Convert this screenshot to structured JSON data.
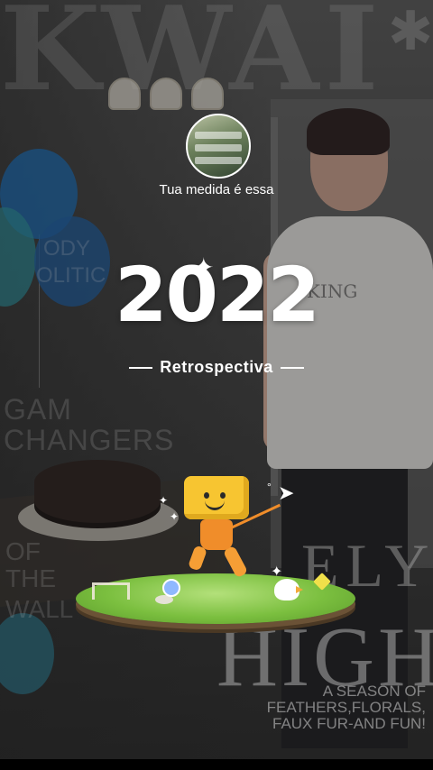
{
  "story": {
    "caption": "Tua medida é essa",
    "year": "2022",
    "subtitle": "Retrospectiva"
  },
  "background_text": {
    "magazine_title": "KWAI",
    "gam": "GAM",
    "changers": "CHANGERS",
    "of": "OF",
    "the": "THE",
    "wall": "WALL",
    "ody": "ODY",
    "olitic": "OLITIC",
    "fly": "ELY",
    "high": "HIGH",
    "season": "A SEASON OF FEATHERS,FLORALS, FAUX FUR-AND FUN!",
    "shirt": "KING"
  },
  "icons": {
    "sparkle": "sparkle-icon",
    "plane": "paper-plane-icon"
  },
  "colors": {
    "accent": "#f7c531",
    "text": "#ffffff"
  }
}
